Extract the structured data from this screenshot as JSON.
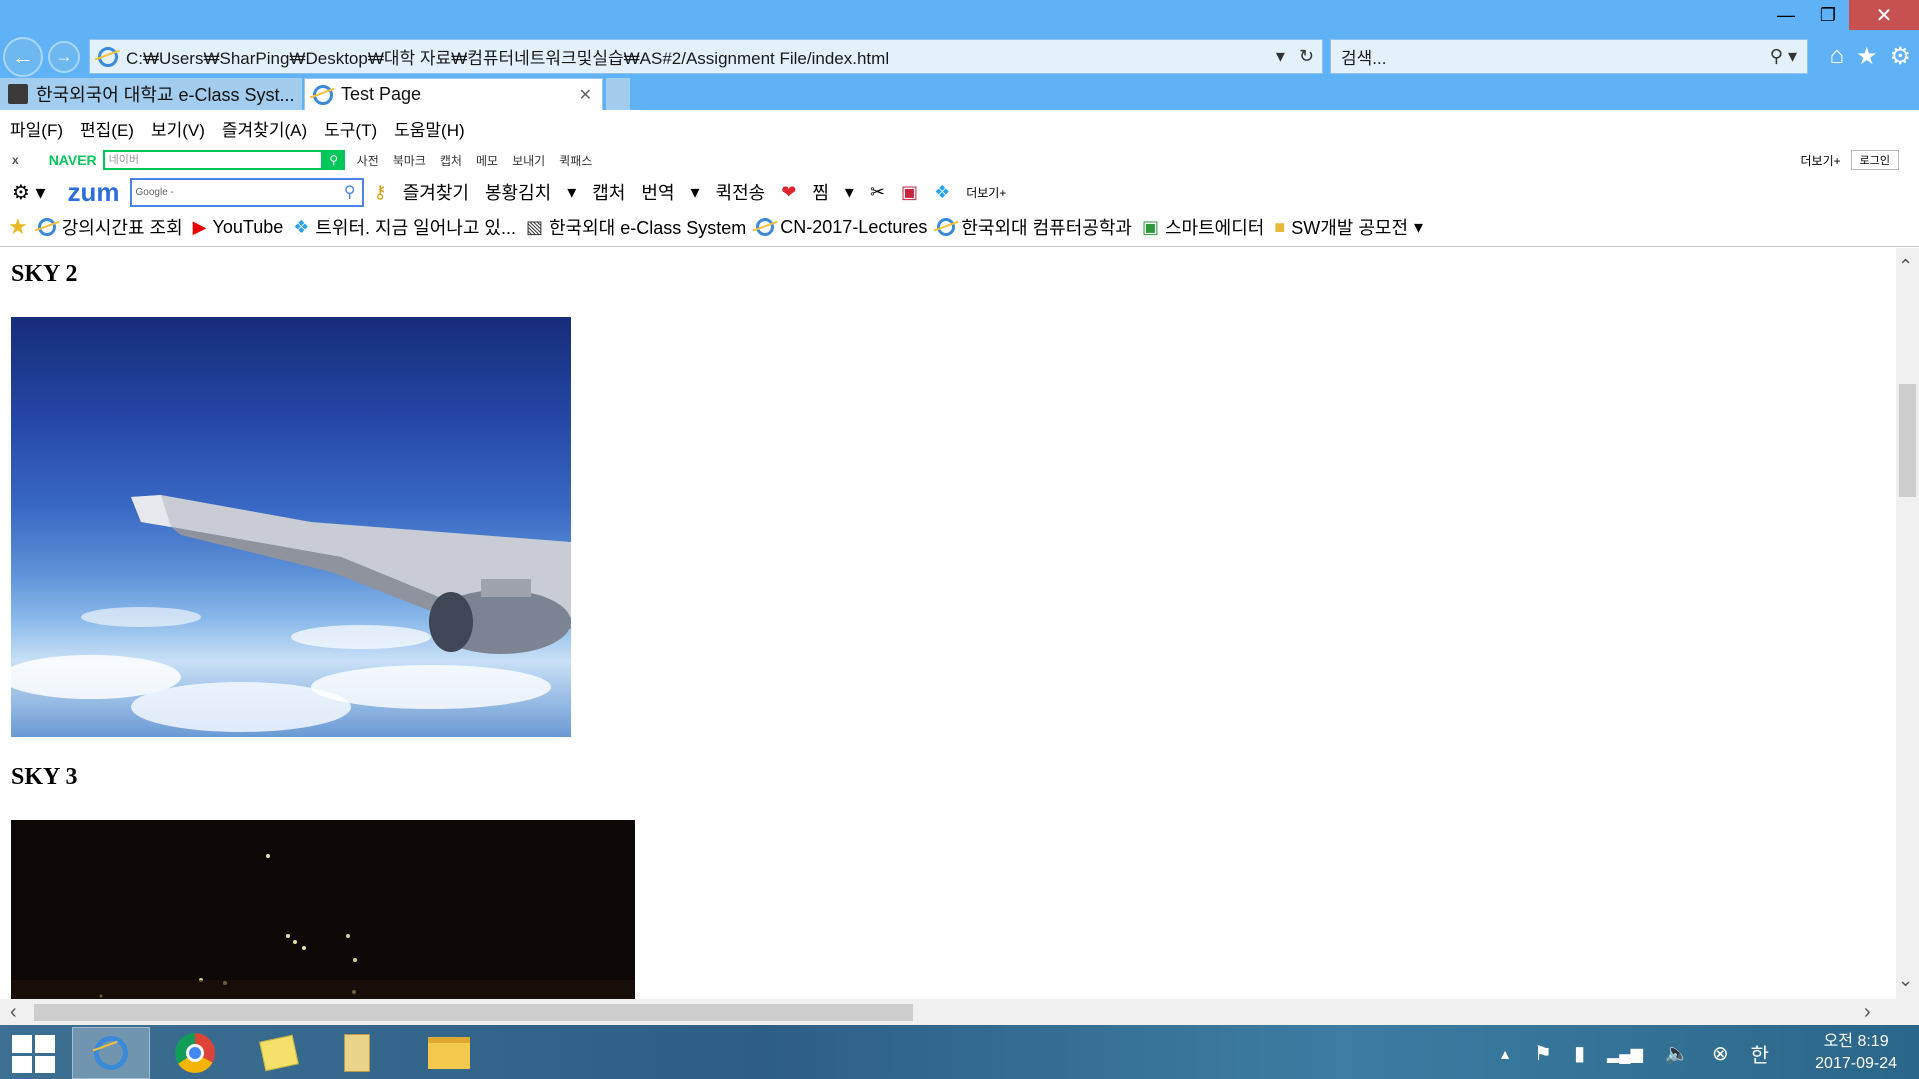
{
  "window": {
    "minimize": "—",
    "restore": "❐",
    "close": "✕"
  },
  "address_bar": {
    "url": "C:₩Users₩SharPing₩Desktop₩대학 자료₩컴퓨터네트워크및실습₩AS#2/Assignment File/index.html"
  },
  "search_bar": {
    "placeholder": "검색..."
  },
  "tabs": [
    {
      "label": "한국외국어 대학교 e-Class Syst...",
      "active": false
    },
    {
      "label": "Test Page",
      "active": true
    }
  ],
  "menu": [
    "파일(F)",
    "편집(E)",
    "보기(V)",
    "즐겨찾기(A)",
    "도구(T)",
    "도움말(H)"
  ],
  "naver_toolbar": {
    "close": "x",
    "logo": "NAVER",
    "search_placeholder": "네이버",
    "items": [
      "사전",
      "북마크",
      "캡처",
      "메모",
      "보내기",
      "퀵패스"
    ],
    "more": "더보기+",
    "login": "로그인"
  },
  "zum_toolbar": {
    "logo": "zum",
    "search_placeholder": "Google -",
    "items": [
      "즐겨찾기",
      "봉황김치",
      "캡처",
      "번역",
      "퀵전송",
      "찜"
    ],
    "more": "더보기+"
  },
  "favorites": [
    {
      "label": "강의시간표 조회",
      "icon": "ie-page-icon"
    },
    {
      "label": "YouTube",
      "icon": "youtube-icon"
    },
    {
      "label": "트위터. 지금 일어나고 있...",
      "icon": "twitter-icon"
    },
    {
      "label": "한국외대 e-Class System",
      "icon": "eclass-icon"
    },
    {
      "label": "CN-2017-Lectures",
      "icon": "ie-page-icon"
    },
    {
      "label": "한국외대 컴퓨터공학과",
      "icon": "ie-page-icon"
    },
    {
      "label": "스마트에디터",
      "icon": "editor-icon"
    },
    {
      "label": "SW개발 공모전",
      "icon": "folder-icon"
    }
  ],
  "page": {
    "sections": [
      {
        "heading": "SKY 2",
        "image": "airplane wing above clouds"
      },
      {
        "heading": "SKY 3",
        "image": "night city lights"
      }
    ]
  },
  "taskbar": {
    "apps": [
      "internet-explorer-icon",
      "chrome-icon",
      "sticky-notes-icon",
      "file-icon",
      "file-explorer-icon"
    ],
    "ime": "한",
    "time": "오전 8:19",
    "date": "2017-09-24"
  }
}
